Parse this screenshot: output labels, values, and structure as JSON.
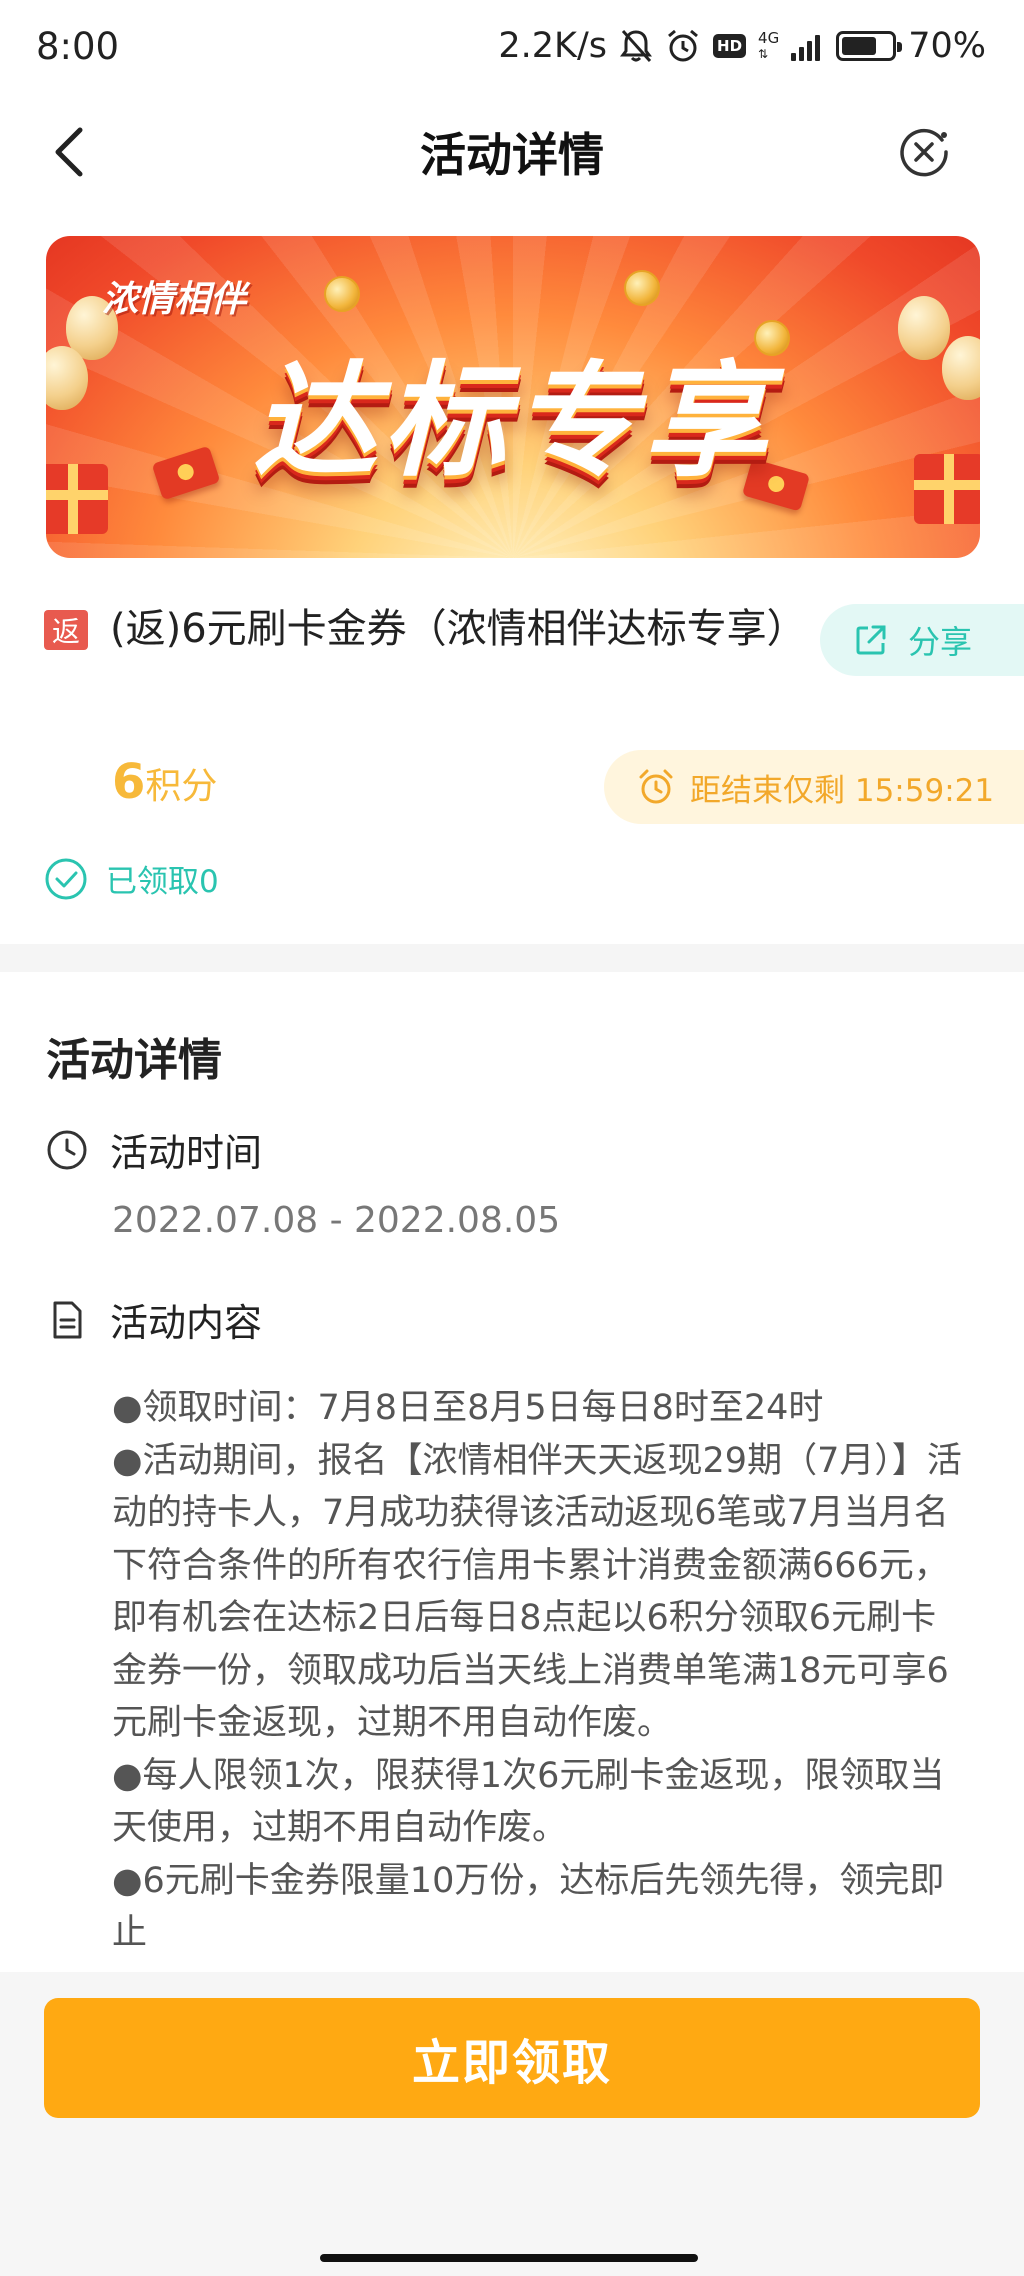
{
  "status_bar": {
    "time": "8:00",
    "speed": "2.2K/s",
    "network": "4G",
    "hd_label": "HD",
    "battery_percent": "70%",
    "battery_level": 0.7
  },
  "nav": {
    "title": "活动详情"
  },
  "banner": {
    "brand": "浓情相伴",
    "headline": "达标专享"
  },
  "product": {
    "badge": "返",
    "title": "(返)6元刷卡金券（浓情相伴达标专享）",
    "share_label": "分享",
    "points_value": "6",
    "points_unit": "积分",
    "countdown_text": "距结束仅剩 15:59:21",
    "claimed_text": "已领取0"
  },
  "details": {
    "section_title": "活动详情",
    "time_label": "活动时间",
    "time_value": "2022.07.08 - 2022.08.05",
    "content_label": "活动内容",
    "content": [
      "●领取时间：7月8日至8月5日每日8时至24时",
      "●活动期间，报名【浓情相伴天天返现29期（7月）】活动的持卡人，7月成功获得该活动返现6笔或7月当月名下符合条件的所有农行信用卡累计消费金额满666元，即有机会在达标2日后每日8点起以6积分领取6元刷卡金券一份，领取成功后当天线上消费单笔满18元可享6元刷卡金返现，过期不用自动作废。",
      "●每人限领1次，限获得1次6元刷卡金返现，限领取当天使用，过期不用自动作废。",
      "●6元刷卡金券限量10万份，达标后先领先得，领完即止"
    ]
  },
  "action": {
    "claim_label": "立即领取"
  },
  "colors": {
    "accent_orange": "#ffa912",
    "teal": "#2ac4b0",
    "points_yellow": "#f7b93a",
    "badge_red": "#e85a4f"
  }
}
